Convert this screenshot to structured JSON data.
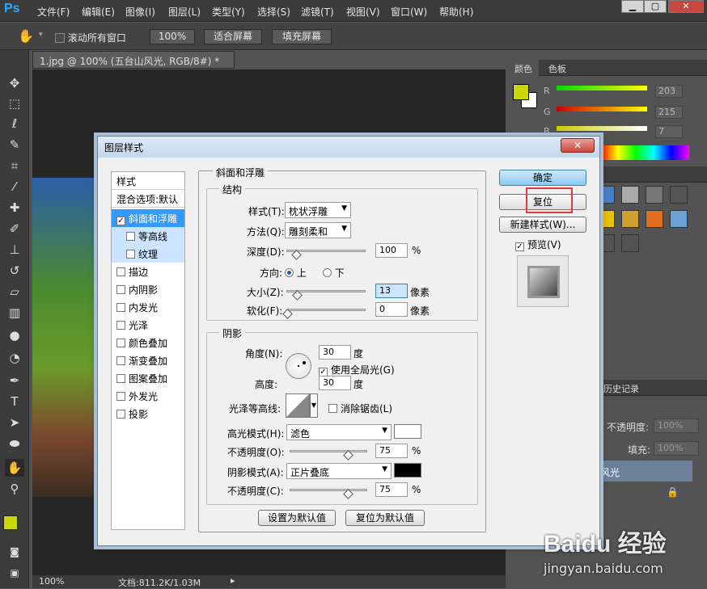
{
  "app": {
    "logo": "Ps"
  },
  "menu": [
    "文件(F)",
    "编辑(E)",
    "图像(I)",
    "图层(L)",
    "类型(Y)",
    "选择(S)",
    "滤镜(T)",
    "视图(V)",
    "窗口(W)",
    "帮助(H)"
  ],
  "options": {
    "scroll_all": "滚动所有窗口",
    "zoom_btn": "100%",
    "fit_screen": "适合屏幕",
    "fill_screen": "填充屏幕"
  },
  "document": {
    "tab_title": "1.jpg @ 100% (五台山风光, RGB/8#) *",
    "zoom": "100%",
    "doc_info": "文档:811.2K/1.03M"
  },
  "right_panel": {
    "color_tab": "颜色",
    "swatch_tab": "色板",
    "r_label": "R",
    "g_label": "G",
    "b_label": "B",
    "r_value": "203",
    "g_value": "215",
    "b_value": "7",
    "history_tab": "历史记录",
    "opacity_label": "不透明度:",
    "opacity_value": "100%",
    "fill_label": "填充:",
    "fill_value": "100%",
    "layer_name": "风光",
    "fg_color": "#cbd707",
    "bg_color": "#ffffff"
  },
  "dialog": {
    "title": "图层样式",
    "close": "✕",
    "style_list": {
      "header": "样式",
      "blend": "混合选项:默认",
      "items": [
        {
          "label": "斜面和浮雕",
          "checked": true,
          "selected": true
        },
        {
          "label": "等高线",
          "checked": false,
          "sub": true
        },
        {
          "label": "纹理",
          "checked": false,
          "sub": true
        },
        {
          "label": "描边",
          "checked": false
        },
        {
          "label": "内阴影",
          "checked": false
        },
        {
          "label": "内发光",
          "checked": false
        },
        {
          "label": "光泽",
          "checked": false
        },
        {
          "label": "颜色叠加",
          "checked": false
        },
        {
          "label": "渐变叠加",
          "checked": false
        },
        {
          "label": "图案叠加",
          "checked": false
        },
        {
          "label": "外发光",
          "checked": false
        },
        {
          "label": "投影",
          "checked": false
        }
      ]
    },
    "bevel": {
      "section_title": "斜面和浮雕",
      "structure_title": "结构",
      "style_label": "样式(T):",
      "style_value": "枕状浮雕",
      "method_label": "方法(Q):",
      "method_value": "雕刻柔和",
      "depth_label": "深度(D):",
      "depth_value": "100",
      "depth_unit": "%",
      "direction_label": "方向:",
      "dir_up": "上",
      "dir_down": "下",
      "size_label": "大小(Z):",
      "size_value": "13",
      "size_unit": "像素",
      "soften_label": "软化(F):",
      "soften_value": "0",
      "soften_unit": "像素"
    },
    "shading": {
      "section_title": "阴影",
      "angle_label": "角度(N):",
      "angle_value": "30",
      "angle_unit": "度",
      "global_light": "使用全局光(G)",
      "altitude_label": "高度:",
      "altitude_value": "30",
      "altitude_unit": "度",
      "gloss_label": "光泽等高线:",
      "antialias": "消除锯齿(L)",
      "highlight_mode_label": "高光模式(H):",
      "highlight_mode_value": "滤色",
      "highlight_opacity_label": "不透明度(O):",
      "highlight_opacity_value": "75",
      "highlight_opacity_unit": "%",
      "shadow_mode_label": "阴影模式(A):",
      "shadow_mode_value": "正片叠底",
      "shadow_opacity_label": "不透明度(C):",
      "shadow_opacity_value": "75",
      "shadow_opacity_unit": "%",
      "highlight_color": "#ffffff",
      "shadow_color": "#000000"
    },
    "make_default": "设置为默认值",
    "reset_default": "复位为默认值",
    "ok": "确定",
    "reset": "复位",
    "new_style": "新建样式(W)...",
    "preview": "预览(V)"
  },
  "watermark": {
    "brand": "Baidu 经验",
    "url": "jingyan.baidu.com"
  }
}
